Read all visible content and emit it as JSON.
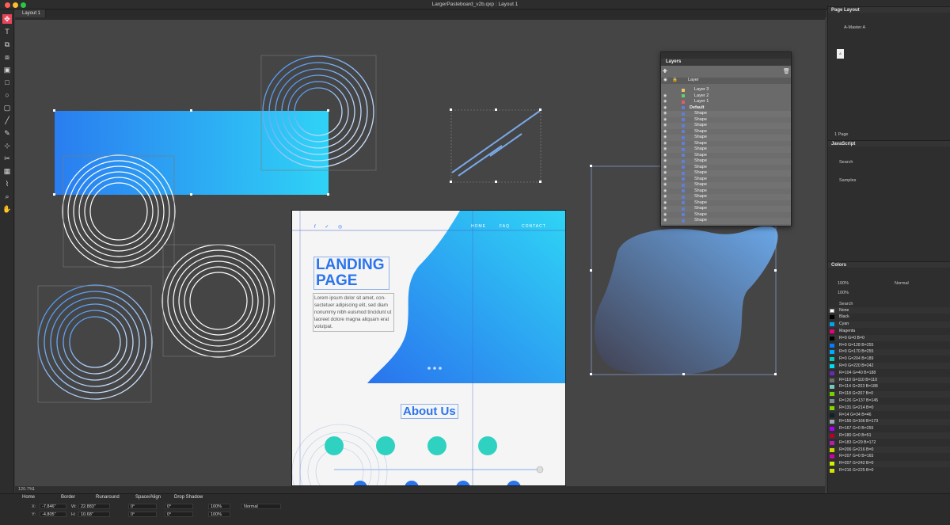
{
  "window": {
    "title": "LargerPasteboard_v2b.qxp : Layout 1",
    "layout_tab": "Layout 1"
  },
  "status": {
    "zoom": "120.7%",
    "page": "1"
  },
  "landing": {
    "nav": [
      "HOME",
      "FAQ",
      "CONTACT"
    ],
    "title_line1": "LANDING",
    "title_line2": "PAGE",
    "body": "Lorem ipsum dolor sit amet, con- sectetuer adipiscing elit, sed diam nonummy nibh euismod tincidunt ut laoreet dolore magna aliquam erat volutpat.",
    "about": "About Us"
  },
  "layers_panel": {
    "title": "Layers",
    "header_col": "Layer",
    "rows": [
      {
        "name": "Layer 3",
        "color": "#f0c36a",
        "eye": false
      },
      {
        "name": "Layer 2",
        "color": "#63d06a",
        "eye": true
      },
      {
        "name": "Layer 1",
        "color": "#e9596e",
        "eye": true
      },
      {
        "name": "Default",
        "color": "#5f7fd8",
        "eye": true,
        "bold": true
      },
      {
        "name": "Shape",
        "color": "#5f7fd8",
        "eye": true
      },
      {
        "name": "Shape",
        "color": "#5f7fd8",
        "eye": true
      },
      {
        "name": "Shape",
        "color": "#5f7fd8",
        "eye": true
      },
      {
        "name": "Shape",
        "color": "#5f7fd8",
        "eye": true
      },
      {
        "name": "Shape",
        "color": "#5f7fd8",
        "eye": true
      },
      {
        "name": "Shape",
        "color": "#5f7fd8",
        "eye": true
      },
      {
        "name": "Shape",
        "color": "#5f7fd8",
        "eye": true
      },
      {
        "name": "Shape",
        "color": "#5f7fd8",
        "eye": true
      },
      {
        "name": "Shape",
        "color": "#5f7fd8",
        "eye": true
      },
      {
        "name": "Shape",
        "color": "#5f7fd8",
        "eye": true
      },
      {
        "name": "Shape",
        "color": "#5f7fd8",
        "eye": true
      },
      {
        "name": "Shape",
        "color": "#5f7fd8",
        "eye": true
      },
      {
        "name": "Shape",
        "color": "#5f7fd8",
        "eye": true
      },
      {
        "name": "Shape",
        "color": "#5f7fd8",
        "eye": true
      },
      {
        "name": "Shape",
        "color": "#5f7fd8",
        "eye": true
      },
      {
        "name": "Shape",
        "color": "#5f7fd8",
        "eye": true
      },
      {
        "name": "Shape",
        "color": "#5f7fd8",
        "eye": true
      },
      {
        "name": "Shape",
        "color": "#5f7fd8",
        "eye": true
      },
      {
        "name": "Shape",
        "color": "#5f7fd8",
        "eye": true
      }
    ]
  },
  "page_layout": {
    "title": "Page Layout",
    "master": "A-Master A",
    "page_icon": "A",
    "page_count": "1 Page"
  },
  "javascript": {
    "title": "JavaScript",
    "search": "Search",
    "samples": "Samples"
  },
  "colors_panel": {
    "title": "Colors",
    "opacity1": "100%",
    "opacity2": "100%",
    "blend": "Normal",
    "search": "Search",
    "swatches": [
      {
        "name": "None",
        "color": "none"
      },
      {
        "name": "Black",
        "color": "#000000"
      },
      {
        "name": "Cyan",
        "color": "#00a8e8"
      },
      {
        "name": "Magenta",
        "color": "#e6007e"
      },
      {
        "name": "R=0 G=0 B=0",
        "color": "#000000"
      },
      {
        "name": "R=0 G=128 B=255",
        "color": "#0080ff"
      },
      {
        "name": "R=0 G=170 B=255",
        "color": "#00aaff"
      },
      {
        "name": "R=0 G=204 B=189",
        "color": "#00ccbd"
      },
      {
        "name": "R=0 G=220 B=242",
        "color": "#00dcf2"
      },
      {
        "name": "R=104 G=40 B=188",
        "color": "#6828bc"
      },
      {
        "name": "R=110 G=110 B=110",
        "color": "#6e6e6e"
      },
      {
        "name": "R=114 G=203 B=188",
        "color": "#72cbbc"
      },
      {
        "name": "R=118 G=207 B=0",
        "color": "#76cf00"
      },
      {
        "name": "R=126 G=137 B=145",
        "color": "#7e8991"
      },
      {
        "name": "R=131 G=214 B=0",
        "color": "#83d600"
      },
      {
        "name": "R=14 G=34 B=46",
        "color": "#0e222e"
      },
      {
        "name": "R=156 G=166 B=173",
        "color": "#9ca6ad"
      },
      {
        "name": "R=167 G=0 B=255",
        "color": "#a700ff"
      },
      {
        "name": "R=180 G=0 B=51",
        "color": "#b40033"
      },
      {
        "name": "R=183 G=29 B=172",
        "color": "#b71dac"
      },
      {
        "name": "R=206 G=216 B=0",
        "color": "#ced800"
      },
      {
        "name": "R=207 G=0 B=165",
        "color": "#cf00a5"
      },
      {
        "name": "R=207 G=242 B=0",
        "color": "#cff200"
      },
      {
        "name": "R=216 G=225 B=0",
        "color": "#d8e100"
      }
    ]
  },
  "bottom_tabs": [
    "Home",
    "Border",
    "Runaround",
    "Space/Align",
    "Drop Shadow"
  ],
  "measure": {
    "x": "-7.846\"",
    "y": "-4.805\"",
    "w": "22.883\"",
    "h": "10.68\"",
    "angle1": "0°",
    "angle2": "0°",
    "angle3": "0°",
    "angle4": "0°",
    "opacity1": "100%",
    "opacity2": "100%",
    "blend": "Normal",
    "x_label": "X:",
    "y_label": "Y:",
    "w_label": "W:",
    "h_label": "H:"
  },
  "colors": {
    "accent": "#2a74ee",
    "teal": "#2fd2c0",
    "canvas": "#454545"
  }
}
